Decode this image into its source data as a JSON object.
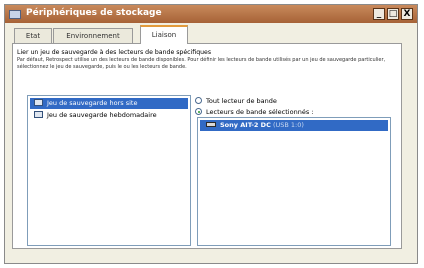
{
  "window": {
    "title": "Périphériques de stockage",
    "minimize_glyph": "_",
    "maximize_glyph": "□",
    "close_glyph": "X"
  },
  "tabs": [
    {
      "label": "Etat"
    },
    {
      "label": "Environnement"
    },
    {
      "label": "Liaison"
    }
  ],
  "active_tab": "Liaison",
  "description": {
    "title": "Lier un jeu de sauvegarde à des lecteurs de bande spécifiques",
    "body": "Par défaut, Retrospect utilise un des lecteurs de bande disponibles. Pour définir les lecteurs de bande utilisés par un jeu de sauvegarde particulier, sélectionnez le jeu de sauvegarde, puis le ou les lecteurs de bande."
  },
  "backup_sets": [
    {
      "label": "Jeu de sauvegarde hors site",
      "selected": true,
      "icon": "backup-set-icon"
    },
    {
      "label": "Jeu de sauvegarde hebdomadaire",
      "selected": false,
      "icon": "backup-set-icon"
    }
  ],
  "options": {
    "all_drives": {
      "label": "Tout lecteur de bande",
      "checked": false
    },
    "selected_drives": {
      "label": "Lecteurs de bande sélectionnés :",
      "checked": true
    }
  },
  "drives": [
    {
      "name": "Sony AIT-2 DC",
      "detail": "(USB 1:0)",
      "selected": true,
      "icon": "tape-drive-icon"
    }
  ],
  "colors": {
    "titlebar": "#b8754a",
    "selection": "#316ac5",
    "active_tab_accent": "#e39b3c"
  }
}
